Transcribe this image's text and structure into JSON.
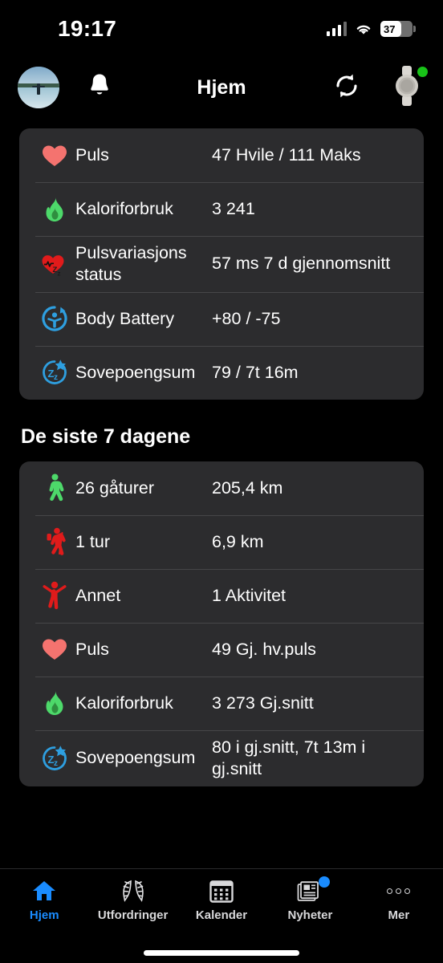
{
  "status_bar": {
    "time": "19:17",
    "signal_icon": "cellular-signal-icon",
    "wifi_icon": "wifi-icon",
    "battery_icon": "battery-icon",
    "battery_percent": "37"
  },
  "nav": {
    "title": "Hjem",
    "avatar_icon": "avatar",
    "notifications_icon": "bell-icon",
    "sync_icon": "sync-icon",
    "device_icon": "watch-icon",
    "device_status_color": "#18c318"
  },
  "today_card": {
    "rows": [
      {
        "icon": "heart-icon",
        "label": "Puls",
        "value": "47 Hvile / 111 Maks"
      },
      {
        "icon": "flame-icon",
        "label": "Kaloriforbruk",
        "value": "3 241"
      },
      {
        "icon": "hrv-heart-sleep-icon",
        "label": "Pulsvariasjons status",
        "value": "57 ms 7 d gjennomsnitt"
      },
      {
        "icon": "body-battery-icon",
        "label": "Body Battery",
        "value": "+80 / -75"
      },
      {
        "icon": "sleep-score-icon",
        "label": "Sovepoengsum",
        "value": "79 / 7t 16m"
      }
    ]
  },
  "last_seven_days": {
    "title": "De siste 7 dagene",
    "rows": [
      {
        "icon": "walking-icon",
        "label": "26 gåturer",
        "value": "205,4 km"
      },
      {
        "icon": "hiking-icon",
        "label": "1 tur",
        "value": "6,9 km"
      },
      {
        "icon": "other-activity-icon",
        "label": "Annet",
        "value": "1 Aktivitet"
      },
      {
        "icon": "heart-icon",
        "label": "Puls",
        "value": "49 Gj. hv.puls"
      },
      {
        "icon": "flame-icon",
        "label": "Kaloriforbruk",
        "value": "3 273 Gj.snitt"
      },
      {
        "icon": "sleep-score-icon",
        "label": "Sovepoengsum",
        "value": "80 i gj.snitt, 7t 13m i gj.snitt"
      }
    ]
  },
  "tabbar": {
    "items": [
      {
        "label": "Hjem",
        "icon": "home-icon",
        "active": true,
        "badge": false
      },
      {
        "label": "Utfordringer",
        "icon": "laurel-wreath-icon",
        "active": false,
        "badge": false
      },
      {
        "label": "Kalender",
        "icon": "calendar-icon",
        "active": false,
        "badge": false
      },
      {
        "label": "Nyheter",
        "icon": "news-icon",
        "active": false,
        "badge": true
      },
      {
        "label": "Mer",
        "icon": "more-dots-icon",
        "active": false,
        "badge": false
      }
    ],
    "active_color": "#1a8cff"
  }
}
